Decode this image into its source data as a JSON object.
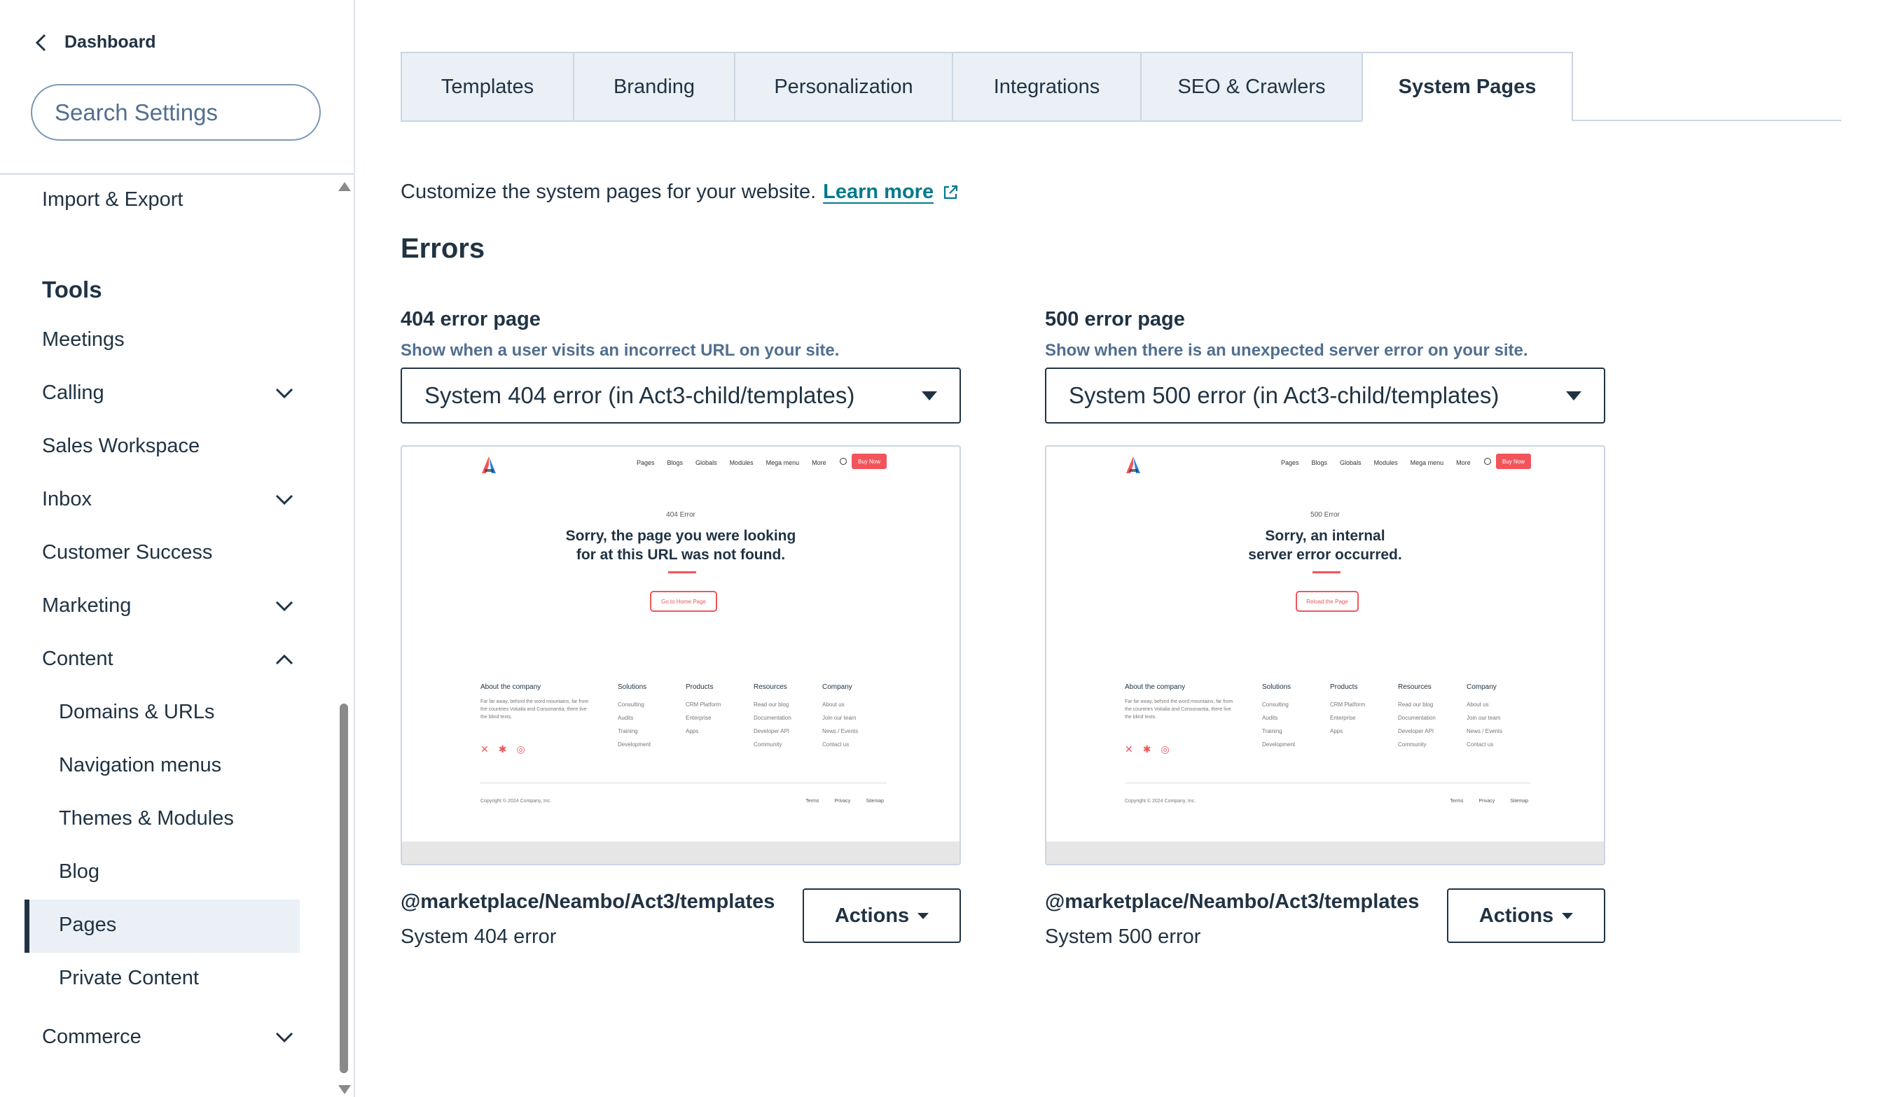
{
  "sidebar": {
    "back_label": "Dashboard",
    "search_placeholder": "Search Settings",
    "import_export": "Import & Export",
    "tools_heading": "Tools",
    "items": {
      "meetings": "Meetings",
      "calling": "Calling",
      "sales_workspace": "Sales Workspace",
      "inbox": "Inbox",
      "customer_success": "Customer Success",
      "marketing": "Marketing",
      "content": "Content",
      "domains": "Domains & URLs",
      "navigation": "Navigation menus",
      "themes": "Themes & Modules",
      "blog": "Blog",
      "pages": "Pages",
      "private_content": "Private Content",
      "commerce": "Commerce"
    },
    "active_item": "Pages"
  },
  "tabs": [
    {
      "label": "Templates"
    },
    {
      "label": "Branding"
    },
    {
      "label": "Personalization"
    },
    {
      "label": "Integrations"
    },
    {
      "label": "SEO & Crawlers"
    },
    {
      "label": "System Pages",
      "active": true
    }
  ],
  "intro": {
    "text": "Customize the system pages for your website.",
    "link": "Learn more"
  },
  "section_title": "Errors",
  "error_pages": [
    {
      "title": "404 error page",
      "help": "Show when a user visits an incorrect URL on your site.",
      "selected": "System 404 error (in Act3-child/templates)",
      "path": "@marketplace/Neambo/Act3/templates",
      "name": "System 404 error",
      "actions_label": "Actions",
      "preview": {
        "tag": "404 Error",
        "heading_line1": "Sorry, the page you were looking",
        "heading_line2": "for at this URL was not found.",
        "button": "Go to Home Page"
      }
    },
    {
      "title": "500 error page",
      "help": "Show when there is an unexpected server error on your site.",
      "selected": "System 500 error (in Act3-child/templates)",
      "path": "@marketplace/Neambo/Act3/templates",
      "name": "System 500 error",
      "actions_label": "Actions",
      "preview": {
        "tag": "500 Error",
        "heading_line1": "Sorry, an internal",
        "heading_line2": "server error occurred.",
        "button": "Reload the Page"
      }
    }
  ],
  "preview_common": {
    "nav": [
      "Pages",
      "Blogs",
      "Globals",
      "Modules",
      "Mega menu",
      "More"
    ],
    "buy": "Buy Now",
    "about_heading": "About the company",
    "about_text": "Far far away, behind the word mountains, far from the countries Vokalia and Consonantia, there live the blind texts.",
    "footer_cols": [
      {
        "heading": "Solutions",
        "items": [
          "Consulting",
          "Audits",
          "Training",
          "Development"
        ]
      },
      {
        "heading": "Products",
        "items": [
          "CRM Platform",
          "Enterprise",
          "Apps"
        ]
      },
      {
        "heading": "Resources",
        "items": [
          "Read our blog",
          "Documentation",
          "Developer API",
          "Community"
        ]
      },
      {
        "heading": "Company",
        "items": [
          "About us",
          "Join our team",
          "News / Events",
          "Contact us"
        ]
      }
    ],
    "copyright": "Copyright © 2024 Company, Inc.",
    "legal": [
      "Terms",
      "Privacy",
      "Sitemap"
    ]
  },
  "colors": {
    "text": "#213343",
    "link": "#007a8c",
    "accent": "#f2545b",
    "tab_bg": "#eaf0f6",
    "border": "#cbd6e2"
  }
}
